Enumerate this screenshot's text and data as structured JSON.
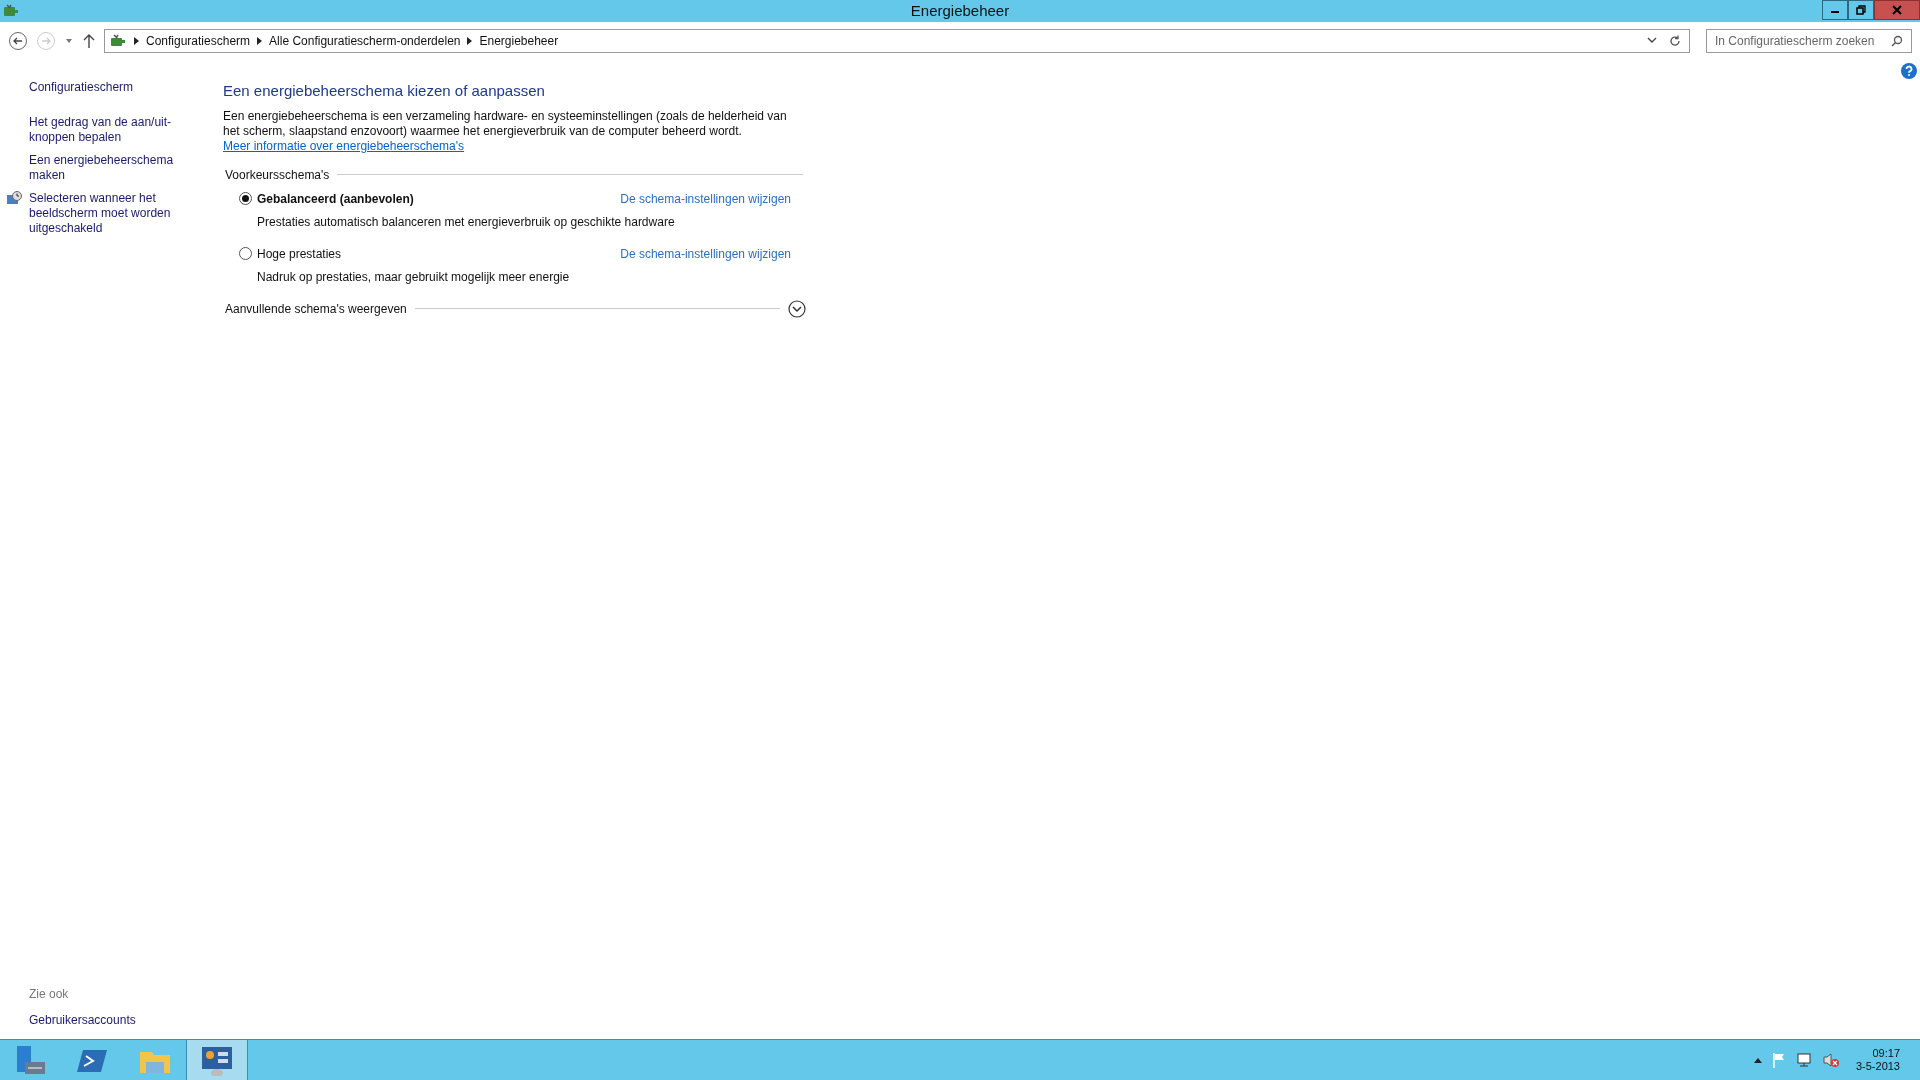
{
  "window": {
    "title": "Energiebeheer"
  },
  "breadcrumb": [
    "Configuratiescherm",
    "Alle Configuratiescherm-onderdelen",
    "Energiebeheer"
  ],
  "search": {
    "placeholder": "In Configuratiescherm zoeken"
  },
  "sidebar": {
    "items": [
      {
        "label": "Configuratiescherm",
        "kind": "plain"
      },
      {
        "label": "Het gedrag van de aan/uit-knoppen bepalen",
        "kind": "plain"
      },
      {
        "label": "Een energiebeheerschema maken",
        "kind": "plain"
      },
      {
        "label": "Selecteren wanneer het beeldscherm moet worden uitgeschakeld",
        "kind": "icon"
      }
    ],
    "see_also_heading": "Zie ook",
    "see_also": [
      "Gebruikersaccounts"
    ]
  },
  "main": {
    "heading": "Een energiebeheerschema kiezen of aanpassen",
    "intro": "Een energiebeheerschema is een verzameling hardware- en systeeminstellingen (zoals de helderheid van het scherm, slaapstand enzovoort) waarmee het energieverbruik van de computer beheerd wordt.",
    "intro_link": "Meer informatie over energiebeheerschema's",
    "group_label": "Voorkeursschema's",
    "plans": [
      {
        "name": "Gebalanceerd (aanbevolen)",
        "selected": true,
        "description": "Prestaties automatisch balanceren met energieverbruik op geschikte hardware",
        "link": "De schema-instellingen wijzigen"
      },
      {
        "name": "Hoge prestaties",
        "selected": false,
        "description": "Nadruk op prestaties, maar gebruikt mogelijk meer energie",
        "link": "De schema-instellingen wijzigen"
      }
    ],
    "more_label": "Aanvullende schema's weergeven",
    "more_expanded": false
  },
  "taskbar": {
    "apps": [
      {
        "kind": "server",
        "selected": false
      },
      {
        "kind": "powershell",
        "selected": false
      },
      {
        "kind": "explorer",
        "selected": false
      },
      {
        "kind": "control",
        "selected": true
      }
    ],
    "time": "09:17",
    "date": "3-5-2013"
  }
}
